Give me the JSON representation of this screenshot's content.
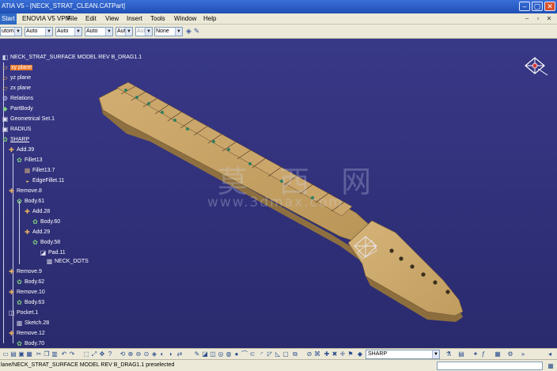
{
  "window": {
    "title": "ATIA V5 - [NECK_STRAT_CLEAN.CATPart]",
    "controls": [
      "–",
      "▢",
      "✕"
    ]
  },
  "menu": {
    "items": [
      "Start",
      "ENOVIA V5 VPM",
      "File",
      "Edit",
      "View",
      "Insert",
      "Tools",
      "Window",
      "Help"
    ],
    "doc_controls": [
      "–",
      "▫",
      "✕"
    ]
  },
  "combobar": {
    "combos": [
      {
        "value": "utoma",
        "disabled": false
      },
      {
        "value": "Auto",
        "disabled": false
      },
      {
        "value": "Auto",
        "disabled": false
      },
      {
        "value": "Auto",
        "disabled": false
      },
      {
        "value": "Aut",
        "disabled": false
      },
      {
        "value": "Aut",
        "disabled": true
      },
      {
        "value": "None",
        "disabled": false
      }
    ]
  },
  "tree": {
    "root": "NECK_STRAT_SURFACE MODEL REV B_DRAG1.1",
    "nodes": [
      {
        "label": "xy plane",
        "icon": "plane-icon",
        "selected": true
      },
      {
        "label": "yz plane",
        "icon": "plane-icon"
      },
      {
        "label": "zx plane",
        "icon": "plane-icon"
      },
      {
        "label": "Relations",
        "icon": "relations-icon"
      },
      {
        "label": "PartBody",
        "icon": "partbody-icon"
      },
      {
        "label": "Geometrical Set.1",
        "icon": "geometrical-set-icon"
      },
      {
        "label": "RADIUS",
        "icon": "geometrical-set-icon"
      },
      {
        "label": "SHARP",
        "icon": "body-icon",
        "underline": true
      },
      {
        "label": "Add.39",
        "icon": "add-icon"
      },
      {
        "label": "Fillet13",
        "icon": "body-icon"
      },
      {
        "label": "Fillet13.7",
        "icon": "fillet-icon"
      },
      {
        "label": "EdgeFillet.11",
        "icon": "edgefillet-icon"
      },
      {
        "label": "Remove.8",
        "icon": "remove-icon"
      },
      {
        "label": "Body.61",
        "icon": "body-icon"
      },
      {
        "label": "Add.28",
        "icon": "add-icon"
      },
      {
        "label": "Body.60",
        "icon": "body-icon"
      },
      {
        "label": "Add.29",
        "icon": "add-icon"
      },
      {
        "label": "Body.58",
        "icon": "body-icon"
      },
      {
        "label": "Pad.11",
        "icon": "pad-icon"
      },
      {
        "label": "NECK_DOTS",
        "icon": "sketch-icon"
      },
      {
        "label": "Remove.9",
        "icon": "remove-icon"
      },
      {
        "label": "Body.62",
        "icon": "body-icon"
      },
      {
        "label": "Remove.10",
        "icon": "remove-icon"
      },
      {
        "label": "Body.63",
        "icon": "body-icon"
      },
      {
        "label": "Pocket.1",
        "icon": "pocket-icon"
      },
      {
        "label": "Sketch.28",
        "icon": "sketch-icon"
      },
      {
        "label": "Remove.12",
        "icon": "remove-icon"
      },
      {
        "label": "Body.70",
        "icon": "body-icon"
      }
    ]
  },
  "watermark": {
    "chinese": "莫 西 网",
    "url": "www.3dmax.com"
  },
  "bottombar": {
    "current_body": "SHARP"
  },
  "status": {
    "text": "lane/NECK_STRAT_SURFACE MODEL REV B_DRAG1.1 preselected",
    "input_value": ""
  },
  "colors": {
    "viewport_bg": "#2f2f7a",
    "selection": "#e8792a",
    "neck_wood": "#c8a46a",
    "fretboard": "#c9a56c",
    "inlay_dots": "#2f8060"
  }
}
